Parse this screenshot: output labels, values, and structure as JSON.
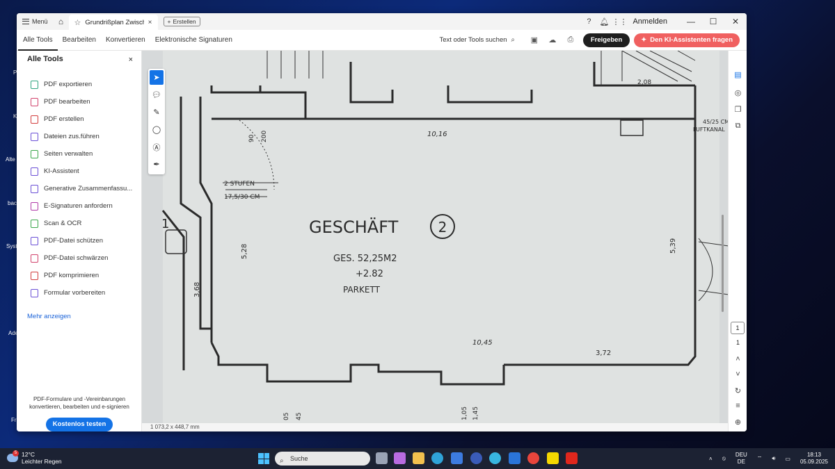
{
  "desktop": {
    "labels": [
      "P",
      "K",
      "Alte",
      "bac",
      "Syste",
      "Ade",
      "Fr"
    ]
  },
  "titlebar": {
    "menu_label": "Menü",
    "tab_title": "Grundrißplan Zwisch...",
    "tab_close": "×",
    "create_label": "Erstellen",
    "signin_label": "Anmelden"
  },
  "toolbar": {
    "tabs": [
      "Alle Tools",
      "Bearbeiten",
      "Konvertieren",
      "Elektronische Signaturen"
    ],
    "search_label": "Text oder Tools suchen",
    "share_label": "Freigeben",
    "ai_label": "Den KI-Assistenten fragen"
  },
  "sidebar": {
    "title": "Alle Tools",
    "close": "×",
    "items": [
      {
        "label": "PDF exportieren",
        "color": "#2da37e"
      },
      {
        "label": "PDF bearbeiten",
        "color": "#d1416b"
      },
      {
        "label": "PDF erstellen",
        "color": "#d23c3c"
      },
      {
        "label": "Dateien zus.führen",
        "color": "#6a4fd6"
      },
      {
        "label": "Seiten verwalten",
        "color": "#3aa64a"
      },
      {
        "label": "KI-Assistent",
        "color": "#6a4fd6"
      },
      {
        "label": "Generative Zusammenfassu...",
        "color": "#6a4fd6"
      },
      {
        "label": "E-Signaturen anfordern",
        "color": "#b03aa8"
      },
      {
        "label": "Scan & OCR",
        "color": "#3aa64a"
      },
      {
        "label": "PDF-Datei schützen",
        "color": "#6a4fd6"
      },
      {
        "label": "PDF-Datei schwärzen",
        "color": "#d1416b"
      },
      {
        "label": "PDF komprimieren",
        "color": "#d23c3c"
      },
      {
        "label": "Formular vorbereiten",
        "color": "#6a4fd6"
      }
    ],
    "more_label": "Mehr anzeigen",
    "promo_text": "PDF-Formulare und -Vereinbarungen konvertieren, bearbeiten und e-signieren",
    "cta_label": "Kostenlos testen"
  },
  "document": {
    "room_title": "GESCHÄFT",
    "room_number": "2",
    "area": "GES. 52,25M2",
    "height": "+2.82",
    "floor": "PARKETT",
    "stairs_label": "2 STUFEN",
    "stairs_size": "17,5/30 CM",
    "dim_top": "10,16",
    "dim_bottom": "10,45",
    "dim_left": "5,28",
    "dim_right": "5,39",
    "dim_side": "3,68",
    "dim_small": "3,72",
    "dim_top_right": "2,08",
    "dim_vert_1": "90",
    "dim_vert_2": "200",
    "dim_bottom_1": "05",
    "dim_bottom_2": "45",
    "dim_bottom_3": "1,05",
    "dim_bottom_4": "1,45",
    "duct": "45/25 CM",
    "duct_label": "LUFTKANAL",
    "room_left_number": "1"
  },
  "statusbar": {
    "size_label": "1 073,2 x 448,7 mm"
  },
  "rightrail": {
    "page_current": "1",
    "page_total": "1"
  },
  "taskbar": {
    "temperature": "12°C",
    "weather_text": "Leichter Regen",
    "weather_badge": "5",
    "search_label": "Suche",
    "lang_1": "DEU",
    "lang_2": "DE",
    "time": "18:13",
    "date": "05.09.2025"
  }
}
